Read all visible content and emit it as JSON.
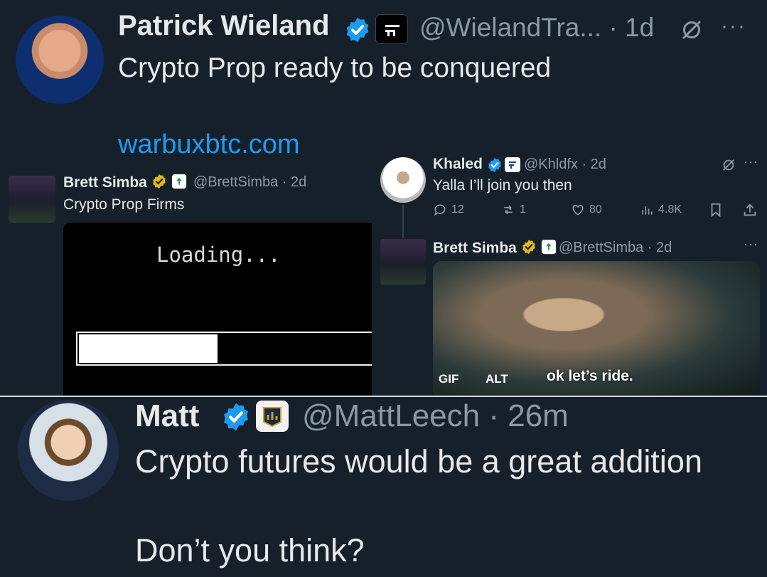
{
  "colors": {
    "background": "#15202b",
    "text": "#e7e9ea",
    "muted": "#8b98a5",
    "link": "#1d9bf0",
    "verified_blue": "#1d9bf0",
    "verified_gold": "#e2b719"
  },
  "top_tweet": {
    "author": "Patrick Wieland",
    "handle_time": "@WielandTra... · 1d",
    "text": "Crypto Prop ready to be conquered",
    "link": "warbuxbtc.com",
    "more": "···",
    "icons": [
      "verified-badge-icon",
      "affiliate-badge-icon",
      "mute-icon",
      "more-icon"
    ]
  },
  "quote_left": {
    "author": "Brett Simba",
    "handle_time": "@BrettSimba · 2d",
    "text": "Crypto Prop Firms",
    "media": {
      "loading_text": "Loading...",
      "progress": 0.46
    }
  },
  "quote_right": {
    "khaled": {
      "author": "Khaled",
      "handle_time": "@Khldfx · 2d",
      "text": "Yalla I’ll join you then",
      "more": "···",
      "actions": {
        "replies": "12",
        "reposts": "1",
        "likes": "80",
        "views": "4.8K"
      }
    },
    "brett": {
      "author": "Brett Simba",
      "handle_time": "@BrettSimba · 2d",
      "more": "···",
      "media": {
        "gif_label": "GIF",
        "alt_label": "ALT",
        "caption": "ok let’s ride."
      }
    }
  },
  "bottom_tweet": {
    "author": "Matt",
    "handle_time": "@MattLeech · 26m",
    "text_line1": "Crypto futures would be a great addition",
    "text_line2": "Don’t you think?"
  }
}
